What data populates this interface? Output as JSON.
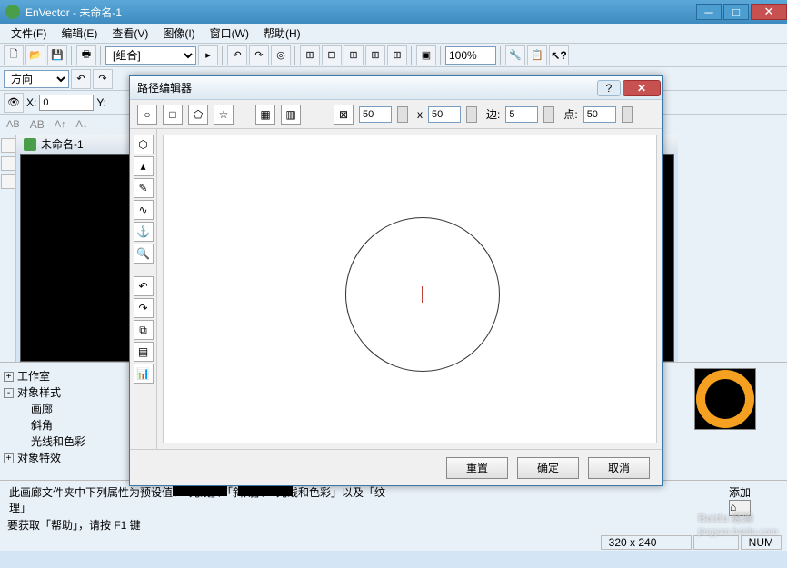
{
  "titlebar": {
    "app": "EnVector",
    "doc": "未命名-1"
  },
  "menus": [
    "文件(F)",
    "编辑(E)",
    "查看(V)",
    "图像(I)",
    "窗口(W)",
    "帮助(H)"
  ],
  "toolbar": {
    "combo": "[组合]",
    "zoom": "100%"
  },
  "direction": {
    "label": "方向"
  },
  "coords": {
    "x_label": "X:",
    "x": "0",
    "y_label": "Y:"
  },
  "doc_tab": "未命名-1",
  "tree": {
    "items": [
      "工作室",
      "对象样式",
      "画廊",
      "斜角",
      "光线和色彩",
      "对象特效"
    ]
  },
  "footer": {
    "msg1": "此画廊文件夹中下列属性为预设值：「光线」、「斜角」、「光线和色彩」以及「纹",
    "msg2": "理」",
    "add": "添加"
  },
  "help_line": "要获取「帮助」，请按 F1 键",
  "status": {
    "dim": "320 x 240",
    "num": "NUM"
  },
  "watermark": {
    "brand": "Baidu 经验",
    "url": "jingyan.baidu.com"
  },
  "dialog": {
    "title": "路径编辑器",
    "w": "50",
    "h": "50",
    "sides_label": "边:",
    "sides": "5",
    "points_label": "点:",
    "points": "50",
    "reset": "重置",
    "ok": "确定",
    "cancel": "取消"
  }
}
